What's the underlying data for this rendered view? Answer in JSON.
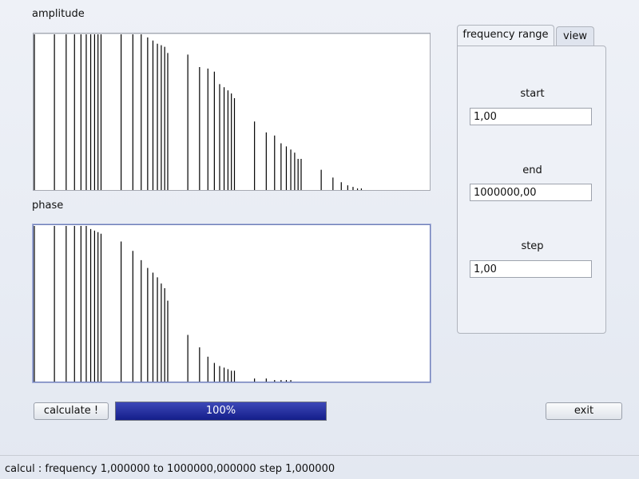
{
  "amplitude_panel": {
    "label": "amplitude"
  },
  "phase_panel": {
    "label": "phase"
  },
  "chart_data": [
    {
      "type": "bar",
      "x_scale": "log",
      "xlim": [
        1,
        1000000
      ],
      "ylim": [
        0,
        1
      ],
      "x": [
        1,
        2,
        3,
        4,
        5,
        6,
        7,
        8,
        9,
        10,
        20,
        30,
        40,
        50,
        60,
        70,
        80,
        90,
        100,
        200,
        300,
        400,
        500,
        600,
        700,
        800,
        900,
        1000,
        2000,
        3000,
        4000,
        5000,
        6000,
        7000,
        8000,
        9000,
        10000,
        20000,
        30000,
        40000,
        50000,
        60000,
        70000,
        80000,
        90000,
        100000
      ],
      "values": [
        1,
        1,
        1,
        1,
        1,
        1,
        1,
        1,
        1,
        1,
        1,
        1,
        1,
        0.98,
        0.96,
        0.94,
        0.93,
        0.92,
        0.88,
        0.87,
        0.79,
        0.78,
        0.76,
        0.68,
        0.66,
        0.64,
        0.62,
        0.59,
        0.44,
        0.37,
        0.35,
        0.3,
        0.28,
        0.26,
        0.24,
        0.2,
        0.2,
        0.13,
        0.08,
        0.05,
        0.03,
        0.02,
        0.01,
        0.01,
        0.0,
        0.0
      ]
    },
    {
      "type": "bar",
      "x_scale": "log",
      "xlim": [
        1,
        1000000
      ],
      "ylim": [
        0,
        1
      ],
      "x": [
        1,
        2,
        3,
        4,
        5,
        6,
        7,
        8,
        9,
        10,
        20,
        30,
        40,
        50,
        60,
        70,
        80,
        90,
        100,
        200,
        300,
        400,
        500,
        600,
        700,
        800,
        900,
        1000,
        2000,
        3000,
        4000,
        5000,
        6000,
        7000,
        8000,
        9000,
        10000,
        20000,
        30000,
        40000,
        50000,
        60000,
        70000,
        80000,
        90000,
        100000
      ],
      "values": [
        1,
        1,
        1,
        1,
        1,
        1,
        0.98,
        0.97,
        0.96,
        0.95,
        0.9,
        0.84,
        0.78,
        0.73,
        0.7,
        0.67,
        0.63,
        0.6,
        0.52,
        0.3,
        0.22,
        0.16,
        0.12,
        0.1,
        0.09,
        0.08,
        0.07,
        0.07,
        0.02,
        0.02,
        0.01,
        0.01,
        0.01,
        0.01,
        0.0,
        0.0,
        0.0,
        0.0,
        0.0,
        0.0,
        0.0,
        0.0,
        0.0,
        0.0,
        0.0,
        0.0
      ]
    }
  ],
  "tabs": [
    {
      "label": "frequency range",
      "active": true
    },
    {
      "label": "view",
      "active": false
    }
  ],
  "range": {
    "start_label": "start",
    "start_value": "1,00",
    "end_label": "end",
    "end_value": "1000000,00",
    "step_label": "step",
    "step_value": "1,00"
  },
  "calculate_label": "calculate !",
  "progress": {
    "value": 1.0,
    "text": "100%"
  },
  "exit_label": "exit",
  "status_text": "calcul : frequency 1,000000 to 1000000,000000 step 1,000000"
}
